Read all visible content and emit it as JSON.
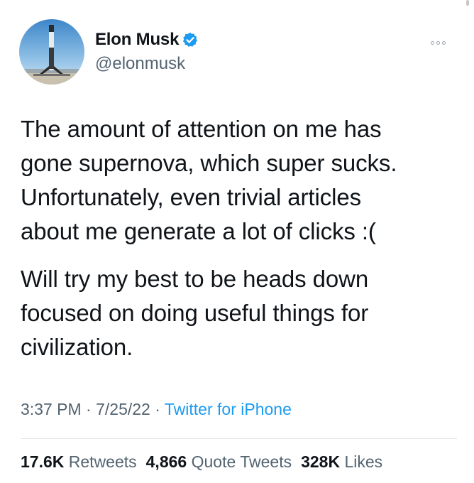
{
  "user": {
    "display_name": "Elon Musk",
    "handle": "@elonmusk",
    "avatar_icon": "rocket-landing-avatar",
    "verified_icon": "verified-badge-icon"
  },
  "more_icon": "more-dots-icon",
  "tweet": {
    "paragraph_1_lines": [
      "The amount of attention on me has",
      "gone supernova, which super sucks.",
      "Unfortunately, even trivial articles",
      "about me generate a lot of clicks :("
    ],
    "paragraph_2_lines": [
      "Will try my best to be heads down",
      "focused on doing useful things for",
      "civilization."
    ]
  },
  "meta": {
    "time": "3:37 PM",
    "sep1": " · ",
    "date": "7/25/22",
    "sep2": " · ",
    "source": "Twitter for iPhone"
  },
  "stats": {
    "retweets_count": "17.6K",
    "retweets_label": "Retweets",
    "quotes_count": "4,866",
    "quotes_label": "Quote Tweets",
    "likes_count": "328K",
    "likes_label": "Likes"
  },
  "colors": {
    "text": "#0f1419",
    "secondary": "#536471",
    "link": "#1d9bf0",
    "verified": "#1d9bf0"
  }
}
